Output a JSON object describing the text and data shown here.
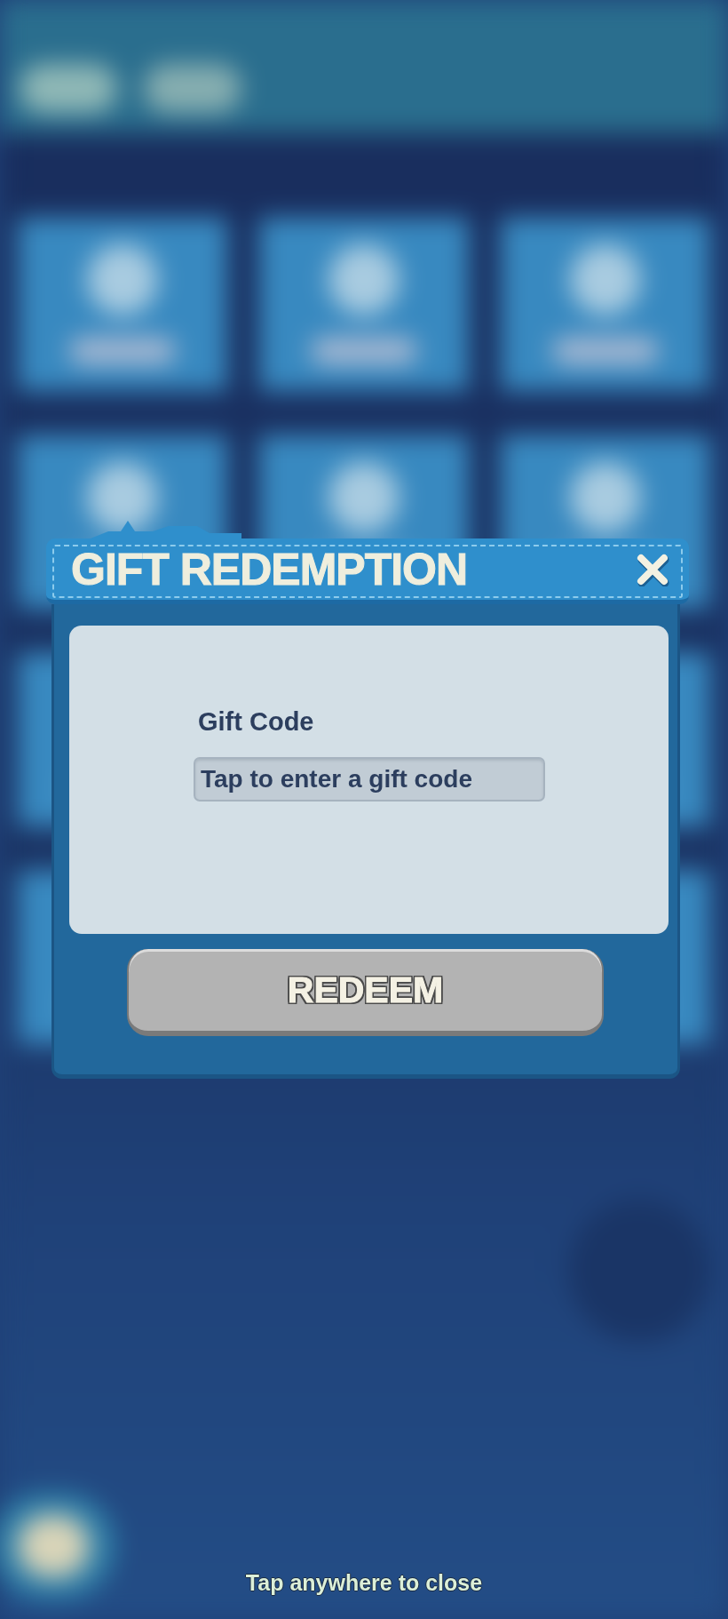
{
  "dialog": {
    "title": "GIFT REDEMPTION",
    "field": {
      "label": "Gift Code",
      "placeholder": "Tap to enter a gift code"
    },
    "button": {
      "label": "REDEEM",
      "disabled": true
    }
  },
  "hint": "Tap anywhere to close"
}
